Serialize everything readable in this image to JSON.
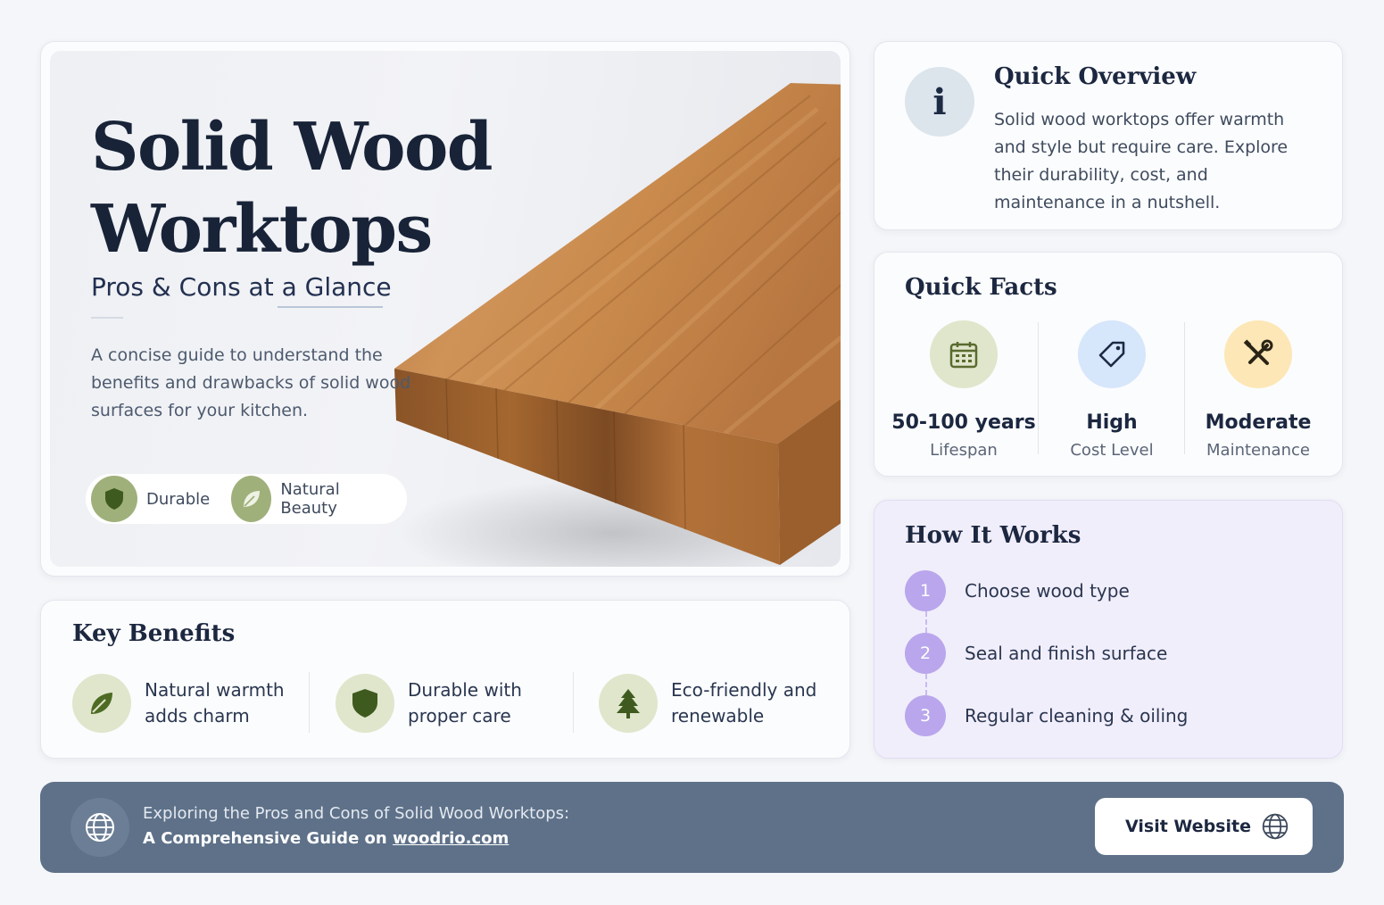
{
  "hero": {
    "title": "Solid Wood Worktops",
    "subtitle": "Pros & Cons at a Glance",
    "description": "A concise guide to understand the benefits and drawbacks of solid wood surfaces for your kitchen.",
    "tags": [
      {
        "label": "Durable",
        "icon": "shield-icon"
      },
      {
        "label": "Natural Beauty",
        "icon": "leaf-icon"
      }
    ]
  },
  "overview": {
    "icon": "info-icon",
    "title": "Quick Overview",
    "text": "Solid wood worktops offer warmth and style but require care. Explore their durability, cost, and maintenance in a nutshell."
  },
  "facts": {
    "title": "Quick Facts",
    "items": [
      {
        "value": "50-100 years",
        "caption": "Lifespan",
        "icon": "calendar-icon",
        "color": "#dfe6cc"
      },
      {
        "value": "High",
        "caption": "Cost Level",
        "icon": "price-tag-icon",
        "color": "#d6e6fb"
      },
      {
        "value": "Moderate",
        "caption": "Maintenance",
        "icon": "tools-icon",
        "color": "#fde7b6"
      }
    ]
  },
  "how": {
    "title": "How It Works",
    "steps": [
      {
        "num": "1",
        "text": "Choose wood type"
      },
      {
        "num": "2",
        "text": "Seal and finish surface"
      },
      {
        "num": "3",
        "text": "Regular cleaning & oiling"
      }
    ]
  },
  "benefits": {
    "title": "Key Benefits",
    "items": [
      {
        "text": "Natural warmth adds charm",
        "icon": "leaf-icon"
      },
      {
        "text": "Durable with proper care",
        "icon": "shield-icon"
      },
      {
        "text": "Eco-friendly and renewable",
        "icon": "tree-icon"
      }
    ]
  },
  "footer": {
    "line1": "Exploring the Pros and Cons of Solid Wood Worktops:",
    "line2_prefix": "A Comprehensive Guide on ",
    "link": "woodrio.com",
    "button": "Visit Website",
    "icon": "globe-icon"
  },
  "colors": {
    "green_accent": "#9fb07a",
    "purple_accent": "#b9a6ec",
    "footer_bg": "#5e7189",
    "wood": "#c9874a"
  }
}
